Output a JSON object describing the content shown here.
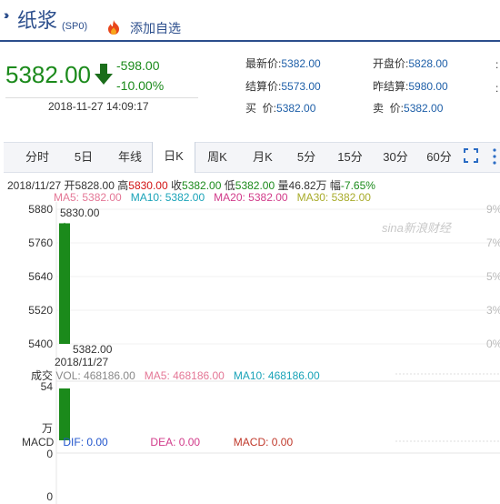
{
  "header": {
    "name": "纸浆",
    "code": "(SP0)",
    "add_favorite": "添加自选"
  },
  "quote": {
    "price": "5382.00",
    "change": "-598.00",
    "change_pct": "-10.00%",
    "timestamp": "2018-11-27 14:09:17",
    "fields": {
      "latest_label": "最新价:",
      "latest": "5382.00",
      "open_label": "开盘价:",
      "open": "5828.00",
      "settle_label": "结算价:",
      "settle": "5573.00",
      "prev_settle_label": "昨结算:",
      "prev_settle": "5980.00",
      "buy_label": "买  价:",
      "buy": "5382.00",
      "sell_label": "卖  价:",
      "sell": "5382.00"
    }
  },
  "tabs": [
    "分时",
    "5日",
    "年线",
    "日K",
    "周K",
    "月K",
    "5分",
    "15分",
    "30分",
    "60分"
  ],
  "active_tab": "日K",
  "kline_info": {
    "date": "2018/11/27",
    "open_label": "开",
    "open": "5828.00",
    "high_label": "高",
    "high": "5830.00",
    "close_label": "收",
    "close": "5382.00",
    "low_label": "低",
    "low": "5382.00",
    "vol_label": "量",
    "vol": "46.82万",
    "amp_label": "幅",
    "amp": "-7.65%"
  },
  "ma_line": {
    "ma5": "MA5: 5382.00",
    "ma10": "MA10: 5382.00",
    "ma20": "MA20: 5382.00",
    "ma30": "MA30: 5382.00"
  },
  "watermark": "sina新浪财经",
  "price_axis": {
    "left_ticks": [
      "5880",
      "5760",
      "5640",
      "5520",
      "5400"
    ],
    "right_ticks": [
      "9%",
      "7%",
      "5%",
      "3%",
      "0%"
    ],
    "high_label": "5830.00",
    "low_label": "5382.00",
    "date_label": "2018/11/27"
  },
  "volume": {
    "label": "成交",
    "vol": "VOL: 468186.00",
    "ma5": "MA5: 468186.00",
    "ma10": "MA10: 468186.00",
    "tick_top": "54",
    "unit": "万"
  },
  "macd": {
    "label": "MACD",
    "dif": "DIF: 0.00",
    "dea": "DEA: 0.00",
    "macd": "MACD: 0.00",
    "tick_a": "0",
    "tick_b": "0"
  },
  "chart_data": {
    "type": "candlestick",
    "x": [
      "2018/11/27"
    ],
    "open": [
      5828.0
    ],
    "high": [
      5830.0
    ],
    "low": [
      5382.0
    ],
    "close": [
      5382.0
    ],
    "volume": [
      468186
    ],
    "ylim": [
      5382,
      5880
    ]
  },
  "colors": {
    "down": "#1b8a1b",
    "up": "#d21414",
    "accent": "#2b4e8c"
  }
}
